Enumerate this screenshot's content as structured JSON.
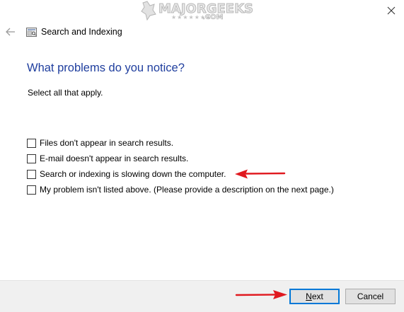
{
  "window": {
    "title": "Search and Indexing",
    "close_icon": "close-icon",
    "back_icon": "back-arrow-icon",
    "app_icon": "search-indexing-icon"
  },
  "watermark": {
    "text": "MAJORGEEKS",
    "suffix": ".COM",
    "stars": "★★★★★★★"
  },
  "main": {
    "heading": "What problems do you notice?",
    "instruction": "Select all that apply.",
    "options": [
      {
        "label": "Files don't appear in search results.",
        "checked": false
      },
      {
        "label": "E-mail doesn't appear in search results.",
        "checked": false
      },
      {
        "label": "Search or indexing is slowing down the computer.",
        "checked": false
      },
      {
        "label": "My problem isn't listed above. (Please provide a description on the next page.)",
        "checked": false
      }
    ]
  },
  "footer": {
    "next_label_mnemonic": "N",
    "next_label_rest": "ext",
    "cancel_label": "Cancel"
  },
  "colors": {
    "heading": "#1f3e9e",
    "annotation_arrow": "#e0191f",
    "default_button_border": "#0078d7",
    "footer_bg": "#f0f0f0"
  }
}
